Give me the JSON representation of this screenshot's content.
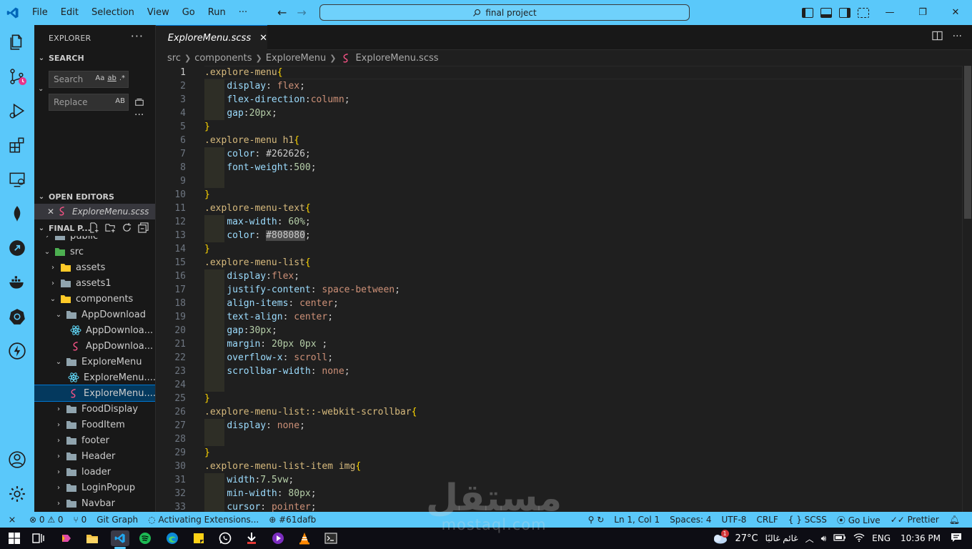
{
  "titlebar": {
    "menu": [
      "File",
      "Edit",
      "Selection",
      "View",
      "Go",
      "Run",
      "···"
    ],
    "search": "final project"
  },
  "sidebar": {
    "header": "EXPLORER",
    "search_section": "SEARCH",
    "search_placeholder": "Search",
    "replace_placeholder": "Replace",
    "search_options": [
      "Aa",
      "ab",
      ".*"
    ],
    "replace_option": "AB",
    "open_editors": "OPEN EDITORS",
    "open_editor_file": "ExploreMenu.scss",
    "project_section": "FINAL P...",
    "tree": [
      {
        "label": "public",
        "depth": 1,
        "kind": "folder",
        "open": false
      },
      {
        "label": "src",
        "depth": 1,
        "kind": "folder-src",
        "open": true
      },
      {
        "label": "assets",
        "depth": 2,
        "kind": "folder-assets",
        "open": false
      },
      {
        "label": "assets1",
        "depth": 2,
        "kind": "folder",
        "open": false
      },
      {
        "label": "components",
        "depth": 2,
        "kind": "folder-components",
        "open": true
      },
      {
        "label": "AppDownload",
        "depth": 3,
        "kind": "folder",
        "open": true
      },
      {
        "label": "AppDownloa...",
        "depth": 4,
        "kind": "react"
      },
      {
        "label": "AppDownloa...",
        "depth": 4,
        "kind": "scss"
      },
      {
        "label": "ExploreMenu",
        "depth": 3,
        "kind": "folder",
        "open": true
      },
      {
        "label": "ExploreMenu....",
        "depth": 4,
        "kind": "react"
      },
      {
        "label": "ExploreMenu....",
        "depth": 4,
        "kind": "scss",
        "selected": true
      },
      {
        "label": "FoodDisplay",
        "depth": 3,
        "kind": "folder",
        "open": false
      },
      {
        "label": "FoodItem",
        "depth": 3,
        "kind": "folder",
        "open": false
      },
      {
        "label": "footer",
        "depth": 3,
        "kind": "folder",
        "open": false
      },
      {
        "label": "Header",
        "depth": 3,
        "kind": "folder",
        "open": false
      },
      {
        "label": "loader",
        "depth": 3,
        "kind": "folder",
        "open": false
      },
      {
        "label": "LoginPopup",
        "depth": 3,
        "kind": "folder",
        "open": false
      },
      {
        "label": "Navbar",
        "depth": 3,
        "kind": "folder",
        "open": false
      }
    ]
  },
  "editor": {
    "tab_label": "ExploreMenu.scss",
    "breadcrumb": [
      "src",
      "components",
      "ExploreMenu",
      "ExploreMenu.scss"
    ],
    "lines": [
      [
        [
          "sel",
          ".explore-menu"
        ],
        [
          "brace",
          "{"
        ]
      ],
      [
        [
          "ind",
          ""
        ],
        [
          "prop",
          "display"
        ],
        [
          "punc",
          ": "
        ],
        [
          "val",
          "flex"
        ],
        [
          "punc",
          ";"
        ]
      ],
      [
        [
          "ind",
          ""
        ],
        [
          "prop",
          "flex-direction"
        ],
        [
          "punc",
          ":"
        ],
        [
          "val",
          "column"
        ],
        [
          "punc",
          ";"
        ]
      ],
      [
        [
          "ind",
          ""
        ],
        [
          "prop",
          "gap"
        ],
        [
          "punc",
          ":"
        ],
        [
          "num",
          "20px"
        ],
        [
          "punc",
          ";"
        ]
      ],
      [
        [
          "brace",
          "}"
        ]
      ],
      [
        [
          "sel",
          ".explore-menu h1"
        ],
        [
          "brace",
          "{"
        ]
      ],
      [
        [
          "ind",
          ""
        ],
        [
          "prop",
          "color"
        ],
        [
          "punc",
          ": "
        ],
        [
          "punc",
          "#262626"
        ],
        [
          "punc",
          ";"
        ]
      ],
      [
        [
          "ind",
          ""
        ],
        [
          "prop",
          "font-weight"
        ],
        [
          "punc",
          ":"
        ],
        [
          "num",
          "500"
        ],
        [
          "punc",
          ";"
        ]
      ],
      [
        [
          "ind",
          ""
        ]
      ],
      [
        [
          "brace",
          "}"
        ]
      ],
      [
        [
          "sel",
          ".explore-menu-text"
        ],
        [
          "brace",
          "{"
        ]
      ],
      [
        [
          "ind",
          ""
        ],
        [
          "prop",
          "max-width"
        ],
        [
          "punc",
          ": "
        ],
        [
          "num",
          "60%"
        ],
        [
          "punc",
          ";"
        ]
      ],
      [
        [
          "ind",
          ""
        ],
        [
          "prop",
          "color"
        ],
        [
          "punc",
          ": "
        ],
        [
          "hl",
          "#808080"
        ],
        [
          "punc",
          ";"
        ]
      ],
      [
        [
          "brace",
          "}"
        ]
      ],
      [
        [
          "sel",
          ".explore-menu-list"
        ],
        [
          "brace",
          "{"
        ]
      ],
      [
        [
          "ind",
          ""
        ],
        [
          "prop",
          "display"
        ],
        [
          "punc",
          ":"
        ],
        [
          "val",
          "flex"
        ],
        [
          "punc",
          ";"
        ]
      ],
      [
        [
          "ind",
          ""
        ],
        [
          "prop",
          "justify-content"
        ],
        [
          "punc",
          ": "
        ],
        [
          "val",
          "space-between"
        ],
        [
          "punc",
          ";"
        ]
      ],
      [
        [
          "ind",
          ""
        ],
        [
          "prop",
          "align-items"
        ],
        [
          "punc",
          ": "
        ],
        [
          "val",
          "center"
        ],
        [
          "punc",
          ";"
        ]
      ],
      [
        [
          "ind",
          ""
        ],
        [
          "prop",
          "text-align"
        ],
        [
          "punc",
          ": "
        ],
        [
          "val",
          "center"
        ],
        [
          "punc",
          ";"
        ]
      ],
      [
        [
          "ind",
          ""
        ],
        [
          "prop",
          "gap"
        ],
        [
          "punc",
          ":"
        ],
        [
          "num",
          "30px"
        ],
        [
          "punc",
          ";"
        ]
      ],
      [
        [
          "ind",
          ""
        ],
        [
          "prop",
          "margin"
        ],
        [
          "punc",
          ": "
        ],
        [
          "num",
          "20px 0px"
        ],
        [
          "punc",
          " ;"
        ]
      ],
      [
        [
          "ind",
          ""
        ],
        [
          "prop",
          "overflow-x"
        ],
        [
          "punc",
          ": "
        ],
        [
          "val",
          "scroll"
        ],
        [
          "punc",
          ";"
        ]
      ],
      [
        [
          "ind",
          ""
        ],
        [
          "prop",
          "scrollbar-width"
        ],
        [
          "punc",
          ": "
        ],
        [
          "val",
          "none"
        ],
        [
          "punc",
          ";"
        ]
      ],
      [
        [
          "ind",
          ""
        ]
      ],
      [
        [
          "brace",
          "}"
        ]
      ],
      [
        [
          "sel",
          ".explore-menu-list::-webkit-scrollbar"
        ],
        [
          "brace",
          "{"
        ]
      ],
      [
        [
          "ind",
          ""
        ],
        [
          "prop",
          "display"
        ],
        [
          "punc",
          ": "
        ],
        [
          "val",
          "none"
        ],
        [
          "punc",
          ";"
        ]
      ],
      [
        [
          "ind",
          ""
        ]
      ],
      [
        [
          "brace",
          "}"
        ]
      ],
      [
        [
          "sel",
          ".explore-menu-list-item img"
        ],
        [
          "brace",
          "{"
        ]
      ],
      [
        [
          "ind",
          ""
        ],
        [
          "prop",
          "width"
        ],
        [
          "punc",
          ":"
        ],
        [
          "num",
          "7.5vw"
        ],
        [
          "punc",
          ";"
        ]
      ],
      [
        [
          "ind",
          ""
        ],
        [
          "prop",
          "min-width"
        ],
        [
          "punc",
          ": "
        ],
        [
          "num",
          "80px"
        ],
        [
          "punc",
          ";"
        ]
      ],
      [
        [
          "ind",
          ""
        ],
        [
          "prop",
          "cursor"
        ],
        [
          "punc",
          ": "
        ],
        [
          "val",
          "pointer"
        ],
        [
          "punc",
          ";"
        ]
      ]
    ]
  },
  "statusbar": {
    "problems": "0",
    "warnings": "0",
    "ports": "0",
    "git_graph": "Git Graph",
    "activating": "Activating Extensions...",
    "commit": "#61dafb",
    "position": "Ln 1, Col 1",
    "spaces": "Spaces: 4",
    "encoding": "UTF-8",
    "eol": "CRLF",
    "language": "SCSS",
    "golive": "Go Live",
    "prettier": "Prettier"
  },
  "taskbar": {
    "weather": "27°C",
    "weather_text": "غائم غالبًا",
    "lang": "ENG",
    "time": "10:36 PM",
    "notification_count": "1"
  },
  "watermark": {
    "arabic": "مستقل",
    "latin": "mostaql.com"
  },
  "colors": {
    "accent": "#5ac8fa",
    "editor_bg": "#1f1f1f",
    "sidebar_bg": "#181818",
    "selection": "#04395e",
    "scss_pink": "#f55385",
    "react_blue": "#61dafb",
    "folder_yellow": "#dcb67a"
  }
}
